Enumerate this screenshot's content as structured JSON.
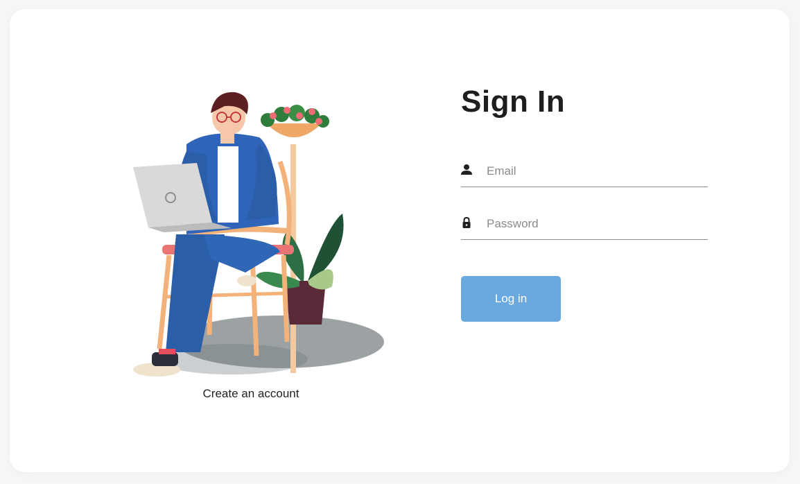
{
  "signin": {
    "title": "Sign In",
    "email_placeholder": "Email",
    "password_placeholder": "Password",
    "login_label": "Log in"
  },
  "create_account": {
    "label": "Create an account"
  },
  "colors": {
    "login_button": "#6aa9e0",
    "title": "#1e1e1e",
    "underline": "#8e8e8e"
  },
  "icons": {
    "email": "user-icon",
    "password": "lock-icon"
  }
}
